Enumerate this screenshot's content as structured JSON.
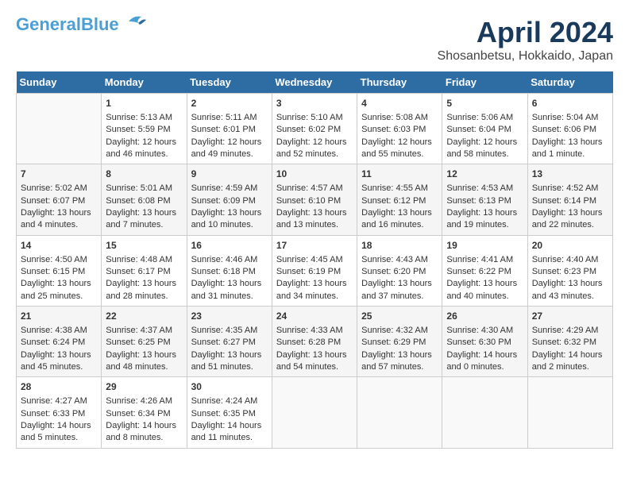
{
  "header": {
    "logo_general": "General",
    "logo_blue": "Blue",
    "title": "April 2024",
    "subtitle": "Shosanbetsu, Hokkaido, Japan"
  },
  "calendar": {
    "days_of_week": [
      "Sunday",
      "Monday",
      "Tuesday",
      "Wednesday",
      "Thursday",
      "Friday",
      "Saturday"
    ],
    "weeks": [
      [
        {
          "day": "",
          "content": ""
        },
        {
          "day": "1",
          "content": "Sunrise: 5:13 AM\nSunset: 5:59 PM\nDaylight: 12 hours\nand 46 minutes."
        },
        {
          "day": "2",
          "content": "Sunrise: 5:11 AM\nSunset: 6:01 PM\nDaylight: 12 hours\nand 49 minutes."
        },
        {
          "day": "3",
          "content": "Sunrise: 5:10 AM\nSunset: 6:02 PM\nDaylight: 12 hours\nand 52 minutes."
        },
        {
          "day": "4",
          "content": "Sunrise: 5:08 AM\nSunset: 6:03 PM\nDaylight: 12 hours\nand 55 minutes."
        },
        {
          "day": "5",
          "content": "Sunrise: 5:06 AM\nSunset: 6:04 PM\nDaylight: 12 hours\nand 58 minutes."
        },
        {
          "day": "6",
          "content": "Sunrise: 5:04 AM\nSunset: 6:06 PM\nDaylight: 13 hours\nand 1 minute."
        }
      ],
      [
        {
          "day": "7",
          "content": "Sunrise: 5:02 AM\nSunset: 6:07 PM\nDaylight: 13 hours\nand 4 minutes."
        },
        {
          "day": "8",
          "content": "Sunrise: 5:01 AM\nSunset: 6:08 PM\nDaylight: 13 hours\nand 7 minutes."
        },
        {
          "day": "9",
          "content": "Sunrise: 4:59 AM\nSunset: 6:09 PM\nDaylight: 13 hours\nand 10 minutes."
        },
        {
          "day": "10",
          "content": "Sunrise: 4:57 AM\nSunset: 6:10 PM\nDaylight: 13 hours\nand 13 minutes."
        },
        {
          "day": "11",
          "content": "Sunrise: 4:55 AM\nSunset: 6:12 PM\nDaylight: 13 hours\nand 16 minutes."
        },
        {
          "day": "12",
          "content": "Sunrise: 4:53 AM\nSunset: 6:13 PM\nDaylight: 13 hours\nand 19 minutes."
        },
        {
          "day": "13",
          "content": "Sunrise: 4:52 AM\nSunset: 6:14 PM\nDaylight: 13 hours\nand 22 minutes."
        }
      ],
      [
        {
          "day": "14",
          "content": "Sunrise: 4:50 AM\nSunset: 6:15 PM\nDaylight: 13 hours\nand 25 minutes."
        },
        {
          "day": "15",
          "content": "Sunrise: 4:48 AM\nSunset: 6:17 PM\nDaylight: 13 hours\nand 28 minutes."
        },
        {
          "day": "16",
          "content": "Sunrise: 4:46 AM\nSunset: 6:18 PM\nDaylight: 13 hours\nand 31 minutes."
        },
        {
          "day": "17",
          "content": "Sunrise: 4:45 AM\nSunset: 6:19 PM\nDaylight: 13 hours\nand 34 minutes."
        },
        {
          "day": "18",
          "content": "Sunrise: 4:43 AM\nSunset: 6:20 PM\nDaylight: 13 hours\nand 37 minutes."
        },
        {
          "day": "19",
          "content": "Sunrise: 4:41 AM\nSunset: 6:22 PM\nDaylight: 13 hours\nand 40 minutes."
        },
        {
          "day": "20",
          "content": "Sunrise: 4:40 AM\nSunset: 6:23 PM\nDaylight: 13 hours\nand 43 minutes."
        }
      ],
      [
        {
          "day": "21",
          "content": "Sunrise: 4:38 AM\nSunset: 6:24 PM\nDaylight: 13 hours\nand 45 minutes."
        },
        {
          "day": "22",
          "content": "Sunrise: 4:37 AM\nSunset: 6:25 PM\nDaylight: 13 hours\nand 48 minutes."
        },
        {
          "day": "23",
          "content": "Sunrise: 4:35 AM\nSunset: 6:27 PM\nDaylight: 13 hours\nand 51 minutes."
        },
        {
          "day": "24",
          "content": "Sunrise: 4:33 AM\nSunset: 6:28 PM\nDaylight: 13 hours\nand 54 minutes."
        },
        {
          "day": "25",
          "content": "Sunrise: 4:32 AM\nSunset: 6:29 PM\nDaylight: 13 hours\nand 57 minutes."
        },
        {
          "day": "26",
          "content": "Sunrise: 4:30 AM\nSunset: 6:30 PM\nDaylight: 14 hours\nand 0 minutes."
        },
        {
          "day": "27",
          "content": "Sunrise: 4:29 AM\nSunset: 6:32 PM\nDaylight: 14 hours\nand 2 minutes."
        }
      ],
      [
        {
          "day": "28",
          "content": "Sunrise: 4:27 AM\nSunset: 6:33 PM\nDaylight: 14 hours\nand 5 minutes."
        },
        {
          "day": "29",
          "content": "Sunrise: 4:26 AM\nSunset: 6:34 PM\nDaylight: 14 hours\nand 8 minutes."
        },
        {
          "day": "30",
          "content": "Sunrise: 4:24 AM\nSunset: 6:35 PM\nDaylight: 14 hours\nand 11 minutes."
        },
        {
          "day": "",
          "content": ""
        },
        {
          "day": "",
          "content": ""
        },
        {
          "day": "",
          "content": ""
        },
        {
          "day": "",
          "content": ""
        }
      ]
    ]
  }
}
